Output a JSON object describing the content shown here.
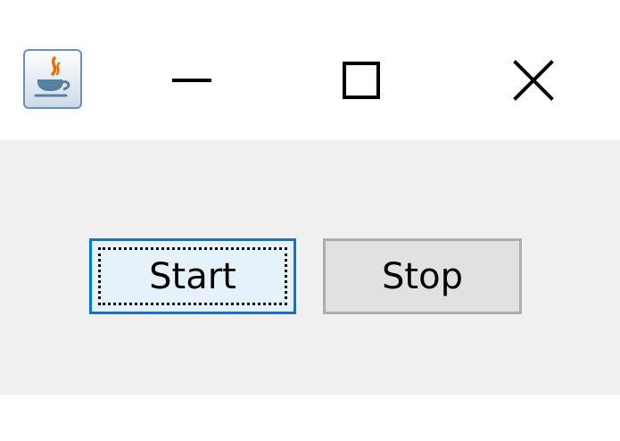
{
  "titlebar": {
    "app_icon": "java-coffee-cup-icon",
    "controls": {
      "minimize_icon": "minimize-icon",
      "maximize_icon": "maximize-icon",
      "close_icon": "close-icon"
    }
  },
  "content": {
    "buttons": [
      {
        "label": "Start",
        "state": "focused"
      },
      {
        "label": "Stop",
        "state": "normal"
      }
    ]
  },
  "colors": {
    "titlebar_bg": "#ffffff",
    "content_bg": "#f0f0f0",
    "focused_border": "#0078d7",
    "focused_fill": "#e5f1fb",
    "button_border": "#adadad",
    "button_fill": "#e1e1e1"
  }
}
